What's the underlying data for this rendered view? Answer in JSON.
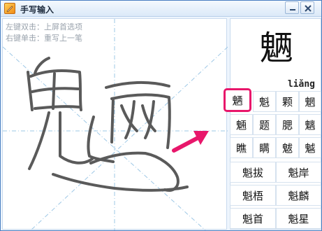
{
  "window": {
    "title": "手写输入",
    "icons": {
      "app": "pen-app-icon",
      "minimize": "minimize-icon",
      "close": "close-icon"
    }
  },
  "pad": {
    "hint_line1": "左键双击：上屏首选项",
    "hint_line2": "右键单击：重写上一笔"
  },
  "candidates": {
    "preview_char": "魉",
    "preview_pinyin": "liǎng",
    "grid_singles": [
      [
        "魉",
        "魁",
        "颗",
        "魍"
      ],
      [
        "魎",
        "题",
        "腮",
        "魑"
      ],
      [
        "瞧",
        "瞒",
        "魃",
        "魆"
      ]
    ],
    "grid_words": [
      [
        "魁拔",
        "魁岸"
      ],
      [
        "魁梧",
        "魁麟"
      ],
      [
        "魁首",
        "魁星"
      ]
    ],
    "selected_index": 0
  },
  "colors": {
    "stroke": "#5a5a5a",
    "guide": "#9ec8e6",
    "highlight": "#e8176b"
  }
}
